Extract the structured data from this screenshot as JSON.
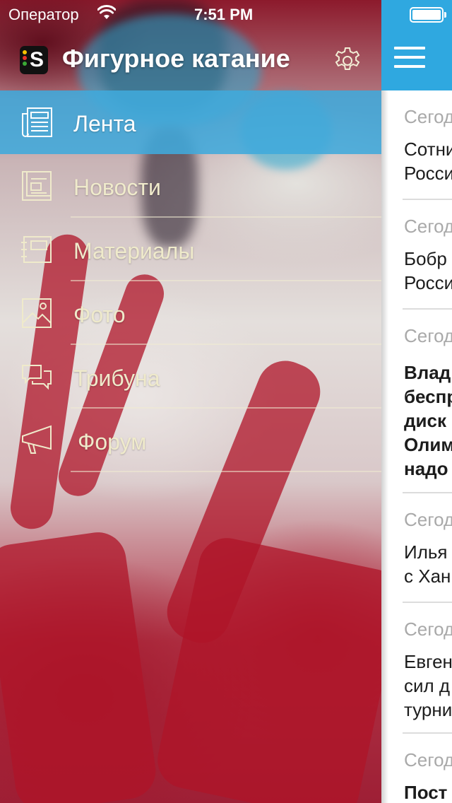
{
  "status_bar": {
    "carrier": "Оператор",
    "time": "7:51 PM"
  },
  "header": {
    "logo_letter": "S",
    "title": "Фигурное катание"
  },
  "menu": {
    "items": [
      {
        "label": "Лента",
        "icon": "newspaper-icon",
        "active": true
      },
      {
        "label": "Новости",
        "icon": "news-page-icon"
      },
      {
        "label": "Материалы",
        "icon": "articles-icon"
      },
      {
        "label": "Фото",
        "icon": "photo-icon"
      },
      {
        "label": "Трибуна",
        "icon": "chat-bubbles-icon"
      },
      {
        "label": "Форум",
        "icon": "megaphone-icon"
      }
    ]
  },
  "feed": {
    "items": [
      {
        "date": "Сегод",
        "lines": [
          "Сотни",
          "Росси"
        ],
        "bold": false
      },
      {
        "date": "Сегод",
        "lines": [
          "Бобр",
          "Росси"
        ],
        "bold": false
      },
      {
        "date": "Сегод",
        "lines": [
          "Влад",
          "беспр",
          "диск",
          "Олим",
          "надо"
        ],
        "bold": true
      },
      {
        "date": "Сегод",
        "lines": [
          "Илья",
          "с Хан"
        ],
        "bold": false
      },
      {
        "date": "Сегод",
        "lines": [
          "Евген",
          "сил д",
          "турни"
        ],
        "bold": false
      },
      {
        "date": "Сегод",
        "lines": [
          "Пост"
        ],
        "bold": true
      }
    ]
  },
  "colors": {
    "accent_blue": "#2fa8e0",
    "menu_active": "#40aadc",
    "menu_text": "#efeacb"
  }
}
